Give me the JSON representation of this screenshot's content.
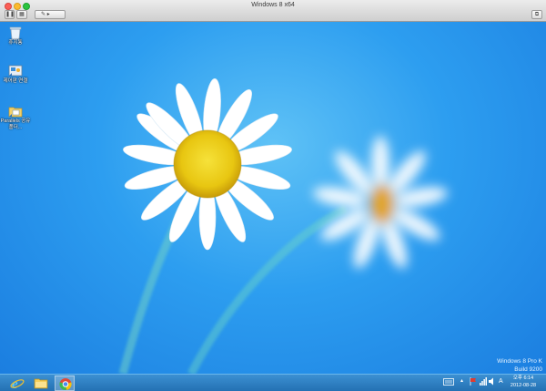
{
  "window": {
    "title": "Windows 8 x64"
  },
  "toolbar": {
    "pause_icon": "pause-icon",
    "snapshot_icon": "snapshot-icon",
    "tools_icon": "wrench-icon"
  },
  "desktop": {
    "icons": [
      {
        "name": "recycle-bin",
        "label": "휴지통",
        "icon": "recycle-bin-icon"
      },
      {
        "name": "control-panel",
        "label": "제어판 연결",
        "icon": "control-panel-icon"
      },
      {
        "name": "parallels-shared",
        "label": "Parallels 공유 폴더...",
        "icon": "shared-folders-icon"
      }
    ],
    "watermark": {
      "line1": "Windows 8 Pro K",
      "line2": "Build 9200"
    }
  },
  "taskbar": {
    "apps": [
      {
        "name": "internet-explorer",
        "icon": "ie-icon"
      },
      {
        "name": "file-explorer",
        "icon": "folder-icon"
      },
      {
        "name": "chrome",
        "icon": "chrome-icon"
      }
    ],
    "tray": {
      "ime": "A"
    },
    "clock": {
      "time": "오후 6:14",
      "date": "2012-08-28"
    }
  }
}
